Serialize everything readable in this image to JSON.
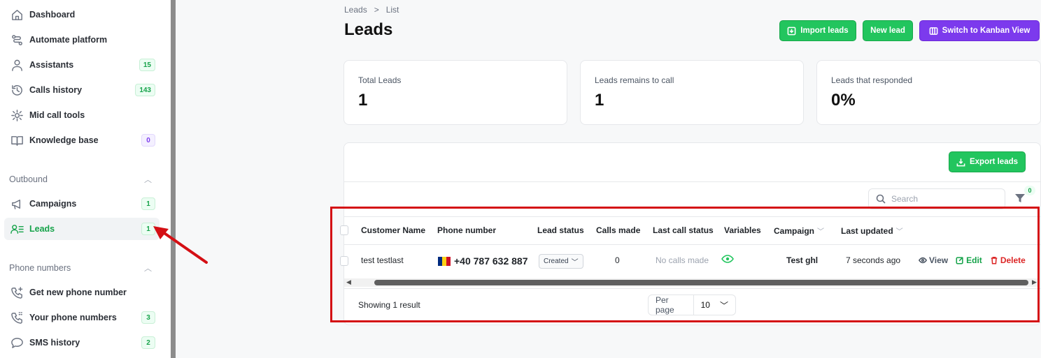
{
  "sidebar": {
    "items": [
      {
        "label": "Dashboard",
        "icon": "home-icon",
        "badge": null
      },
      {
        "label": "Automate platform",
        "icon": "workflow-icon",
        "badge": null
      },
      {
        "label": "Assistants",
        "icon": "user-icon",
        "badge": "15"
      },
      {
        "label": "Calls history",
        "icon": "history-icon",
        "badge": "143"
      },
      {
        "label": "Mid call tools",
        "icon": "tools-icon",
        "badge": null
      },
      {
        "label": "Knowledge base",
        "icon": "book-icon",
        "badge": "0"
      }
    ],
    "outbound": {
      "title": "Outbound",
      "items": [
        {
          "label": "Campaigns",
          "icon": "megaphone-icon",
          "badge": "1"
        },
        {
          "label": "Leads",
          "icon": "leads-icon",
          "badge": "1",
          "active": true
        }
      ]
    },
    "phone_numbers": {
      "title": "Phone numbers",
      "items": [
        {
          "label": "Get new phone number",
          "icon": "phone-plus-icon",
          "badge": null
        },
        {
          "label": "Your phone numbers",
          "icon": "phone-grid-icon",
          "badge": "3"
        },
        {
          "label": "SMS history",
          "icon": "chat-icon",
          "badge": "2"
        }
      ]
    }
  },
  "breadcrumb": {
    "first": "Leads",
    "separator": ">",
    "current": "List"
  },
  "page_title": "Leads",
  "actions": {
    "import": "Import leads",
    "new": "New lead",
    "kanban": "Switch to Kanban View"
  },
  "stats": [
    {
      "label": "Total Leads",
      "value": "1"
    },
    {
      "label": "Leads remains to call",
      "value": "1"
    },
    {
      "label": "Leads that responded",
      "value": "0%"
    }
  ],
  "export_label": "Export leads",
  "search": {
    "placeholder": "Search",
    "value": ""
  },
  "filter_count": "0",
  "table": {
    "columns": [
      "Customer Name",
      "Phone number",
      "Lead status",
      "Calls made",
      "Last call status",
      "Variables",
      "Campaign",
      "Last updated"
    ],
    "rows": [
      {
        "customer_name": "test testlast",
        "phone": "+40 787 632 887",
        "lead_status": "Created",
        "calls_made": "0",
        "last_call_status": "No calls made",
        "campaign": "Test ghl",
        "last_updated": "7 seconds ago",
        "actions": {
          "view": "View",
          "edit": "Edit",
          "delete": "Delete"
        }
      }
    ]
  },
  "footer": {
    "showing": "Showing 1 result",
    "per_page_label": "Per page",
    "per_page_value": "10"
  },
  "colors": {
    "accent_green": "#22c55e",
    "accent_purple": "#7c3aed",
    "highlight_red": "#d40f14",
    "delete_red": "#dc2626"
  }
}
